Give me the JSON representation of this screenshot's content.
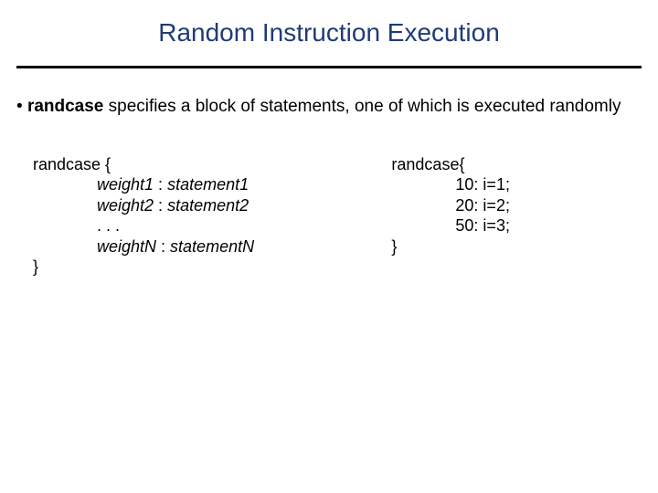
{
  "title": "Random Instruction Execution",
  "bullet": {
    "prefix": "• ",
    "keyword": "randcase",
    "rest": " specifies a block of statements, one of which is executed randomly"
  },
  "syntax": {
    "open": "randcase {",
    "line1a": "weight1",
    "line1b": " : ",
    "line1c": "statement1",
    "line2a": "weight2",
    "line2b": " : ",
    "line2c": "statement2",
    "dots": ". . .",
    "line4a": "weightN",
    "line4b": " : ",
    "line4c": "statementN",
    "close": "}"
  },
  "example": {
    "open": "randcase{",
    "l1": "10: i=1;",
    "l2": "20: i=2;",
    "l3": "50: i=3;",
    "close": "}"
  }
}
